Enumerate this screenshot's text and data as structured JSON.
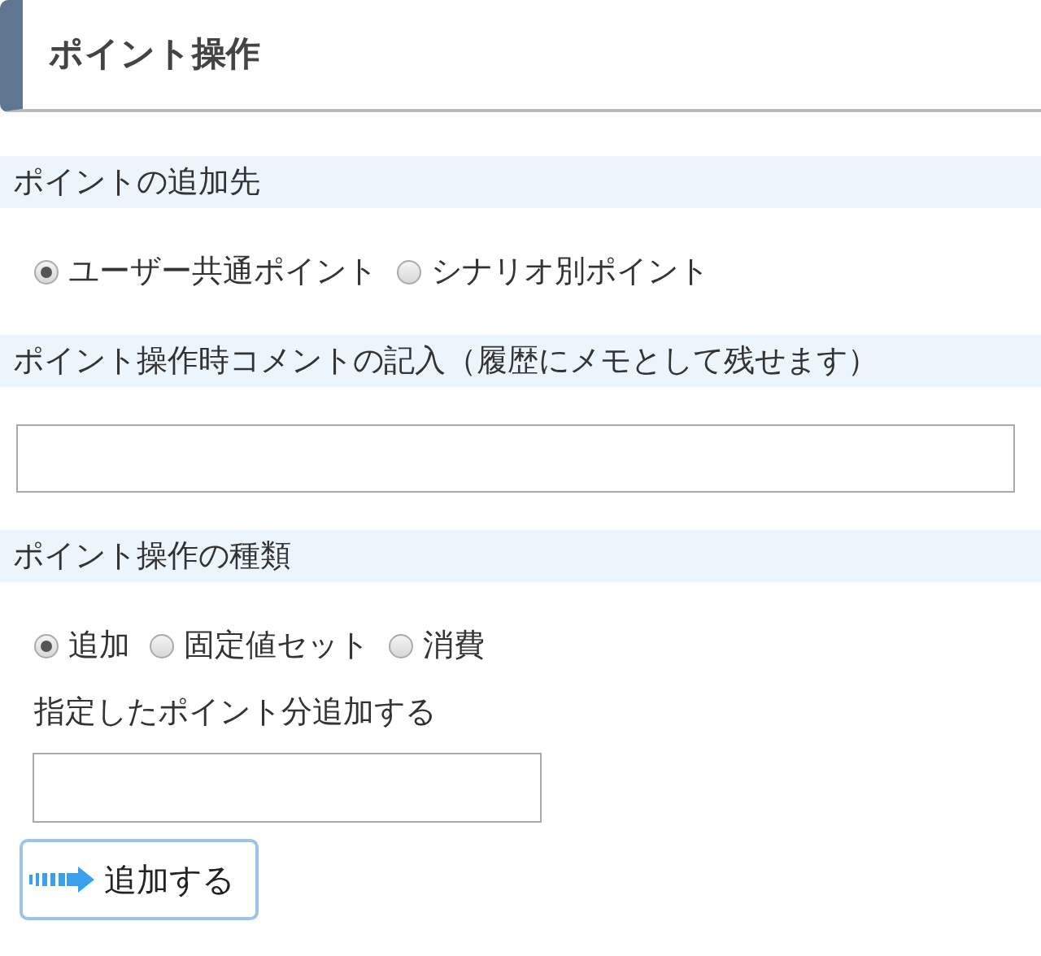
{
  "title": "ポイント操作",
  "destination": {
    "label": "ポイントの追加先",
    "options": [
      {
        "label": "ユーザー共通ポイント",
        "selected": true
      },
      {
        "label": "シナリオ別ポイント",
        "selected": false
      }
    ]
  },
  "comment": {
    "label": "ポイント操作時コメントの記入（履歴にメモとして残せます）"
  },
  "operation": {
    "label": "ポイント操作の種類",
    "options": [
      {
        "label": "追加",
        "selected": true
      },
      {
        "label": "固定値セット",
        "selected": false
      },
      {
        "label": "消費",
        "selected": false
      }
    ],
    "hint": "指定したポイント分追加する"
  },
  "submit": {
    "label": "追加する"
  }
}
